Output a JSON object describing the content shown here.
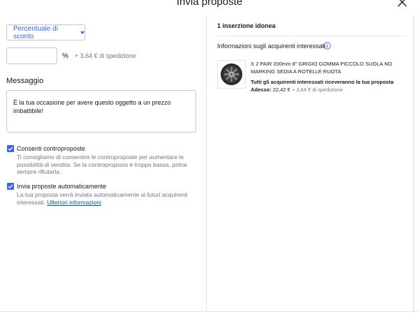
{
  "header": {
    "title": "Invia proposte",
    "close_icon": "close-icon"
  },
  "offer": {
    "discount_type": "Percentuale di sconto",
    "percent_value": "",
    "percent_placeholder": "",
    "percent_sign": "%",
    "shipping_text": "+ 3,64 € di spedizione"
  },
  "message": {
    "label": "Messaggio",
    "text": "È la tua occasione per avere questo oggetto a un prezzo imbattibile!"
  },
  "options": [
    {
      "label": "Consenti controproposte",
      "checked": true,
      "help": "Ti consigliamo di consentire le controproposte per aumentare le possibilità di vendita. Se la controproposta è troppo bassa, potrai sempre rifiutarla."
    },
    {
      "label": "Invia proposte automaticamente",
      "checked": true,
      "help": "La tua proposta verrà inviata automaticamente ai futuri acquirenti interessati.",
      "link": "Ulteriori informazioni"
    }
  ],
  "summary": {
    "count": "1 inserzione idonea",
    "info_label": "Informazioni sugli acquirenti interessati",
    "info_icon": "info-icon"
  },
  "listing": {
    "title": "X 2 PAIR 200mm 8\" GRIGIO GOMMA PICCOLO SUOLA NO MARKING SEDIA A ROTELLE RUOTA",
    "note": "Tutti gli acquirenti interessati riceveranno la tua proposta",
    "price_label": "Adesso:",
    "price_value": "22,42 €",
    "price_shipping": "+ 3,64 € di spedizione",
    "image_icon": "wheel-image"
  },
  "colors": {
    "accent": "#3665f3",
    "link": "#0654ba",
    "muted": "#767676"
  }
}
